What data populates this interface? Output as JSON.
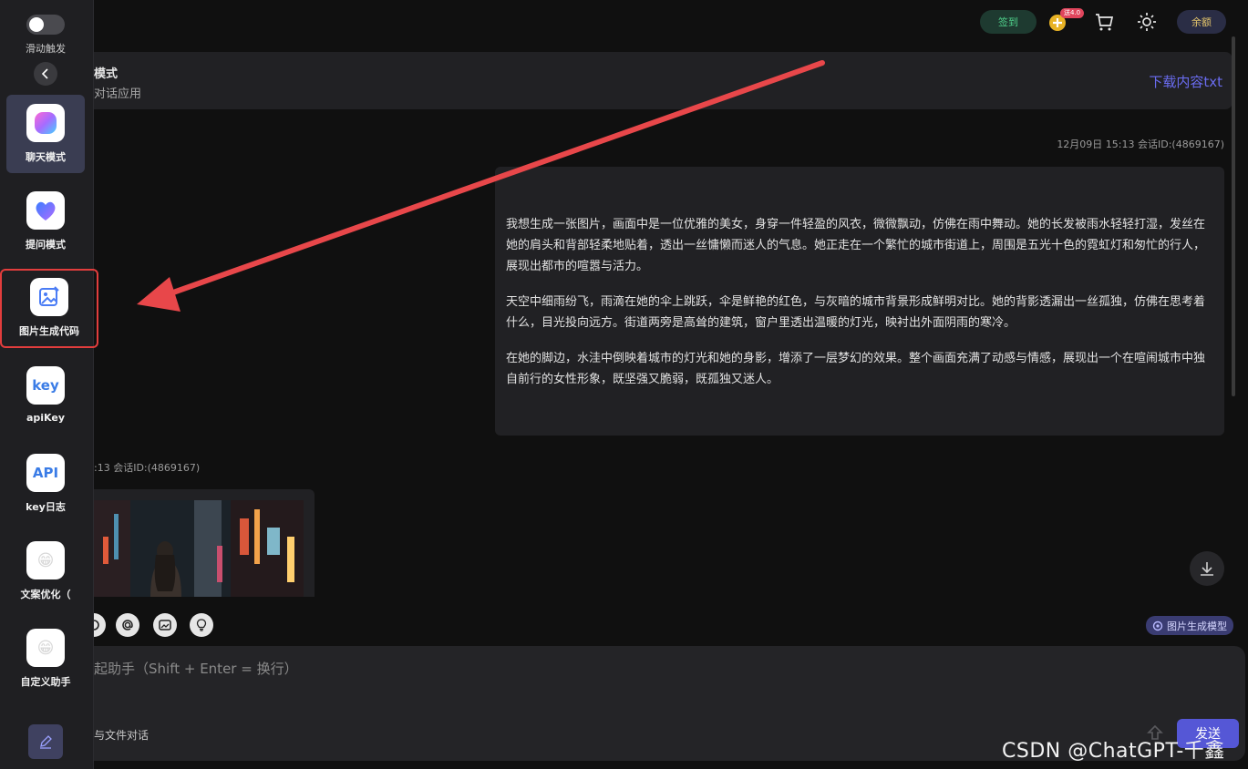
{
  "sidebar": {
    "toggle_label": "滑动触发",
    "items": [
      {
        "label": "聊天模式",
        "icon": "chat-mode-icon"
      },
      {
        "label": "提问模式",
        "icon": "question-mode-icon"
      },
      {
        "label": "图片生成代码",
        "icon": "image-gen-icon"
      },
      {
        "label": "apiKey",
        "icon_text": "key"
      },
      {
        "label": "key日志",
        "icon_text": "API"
      },
      {
        "label": "文案优化（",
        "icon": "grin-emoji-icon",
        "icon_glyph": "😁"
      },
      {
        "label": "自定义助手",
        "icon": "grin-emoji-icon",
        "icon_glyph": "😁"
      }
    ]
  },
  "topbar": {
    "checkin_label": "签到",
    "badge_text": "送4.0",
    "balance_label": "余额"
  },
  "header": {
    "title": "模式",
    "subtitle": "对话应用",
    "download_label": "下载内容txt"
  },
  "messages": {
    "user_meta": "12月09日 15:13 会话ID:(4869167)",
    "user_paragraphs": [
      "我想生成一张图片，画面中是一位优雅的美女，身穿一件轻盈的风衣，微微飘动，仿佛在雨中舞动。她的长发被雨水轻轻打湿，发丝在她的肩头和背部轻柔地贴着，透出一丝慵懒而迷人的气息。她正走在一个繁忙的城市街道上，周围是五光十色的霓虹灯和匆忙的行人，展现出都市的喧嚣与活力。",
      "天空中细雨纷飞，雨滴在她的伞上跳跃，伞是鲜艳的红色，与灰暗的城市背景形成鲜明对比。她的背影透漏出一丝孤独，仿佛在思考着什么，目光投向远方。街道两旁是高耸的建筑，窗户里透出温暖的灯光，映衬出外面阴雨的寒冷。",
      "在她的脚边，水洼中倒映着城市的灯光和她的身影，增添了一层梦幻的效果。整个画面充满了动感与情感，展现出一个在喧闹城市中独自前行的女性形象，既坚强又脆弱，既孤独又迷人。"
    ],
    "ai_meta": ":13 会话ID:(4869167)"
  },
  "tools": {
    "model_tag": "图片生成模型"
  },
  "input": {
    "placeholder": "起助手（Shift + Enter = 换行）",
    "file_chat": "与文件对话",
    "send_label": "发送"
  },
  "watermark": "CSDN @ChatGPT-千鑫",
  "colors": {
    "accent": "#5557d6",
    "highlight": "#e23d3d",
    "arrow": "#e8474a"
  }
}
